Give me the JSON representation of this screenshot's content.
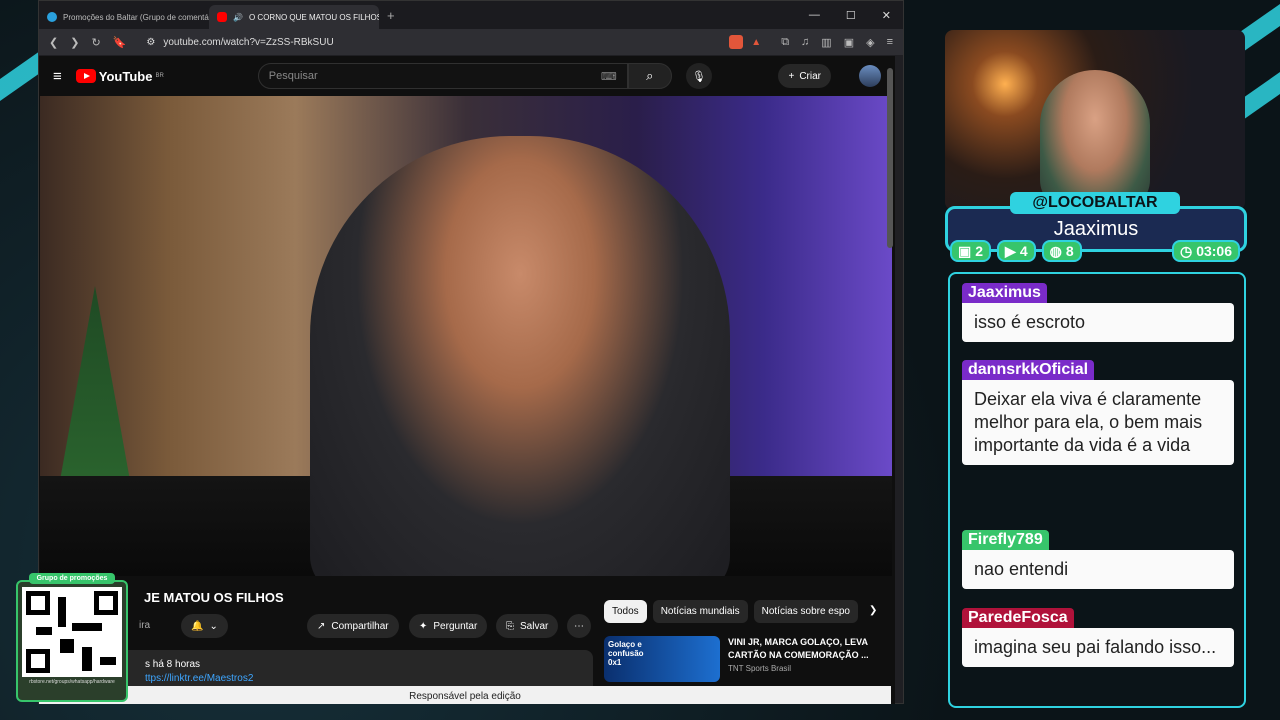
{
  "browser": {
    "tabs": [
      {
        "label": "Promoções do Baltar (Grupo de comentário...",
        "active": false
      },
      {
        "label": "O CORNO QUE MATOU OS FILHOS",
        "active": true
      }
    ],
    "url": "youtube.com/watch?v=ZzSS-RBkSUU"
  },
  "youtube": {
    "logo": "YouTube",
    "region": "BR",
    "search_placeholder": "Pesquisar",
    "create_label": "Criar",
    "video_title_partial": "JE MATOU OS FILHOS",
    "channel_partial": "ira",
    "share_label": "Compartilhar",
    "ask_label": "Perguntar",
    "save_label": "Salvar",
    "desc_time": "s há 8 horas",
    "desc_link": "ttps://linktr.ee/Maestros2",
    "chips": [
      "Todos",
      "Notícias mundiais",
      "Notícias sobre espo"
    ],
    "rec_title": "VINI JR, MARCA GOLAÇO, LEVA CARTÃO NA COMEMORAÇÃO ...",
    "rec_channel": "TNT Sports Brasil",
    "rec_thumb_text": "Golaço e confusão",
    "rec_score": "0x1",
    "footer": "Responsável pela edição"
  },
  "overlay": {
    "qr_header": "Grupo de promoções",
    "qr_footer": "rbstore.net/groups/whatsapp/hardware",
    "handle": "@LOCOBALTAR",
    "current_name": "Jaaximus",
    "stats": {
      "twitch": "2",
      "youtube": "4",
      "kick": "8",
      "timer": "03:06"
    },
    "accent": "#2fd2e0"
  },
  "chat": [
    {
      "user": "Jaaximus",
      "color": "#7a2bc9",
      "text": "isso é escroto"
    },
    {
      "user": "dannsrkkOficial",
      "color": "#7a2bc9",
      "text": "Deixar ela viva é claramente melhor para ela, o bem mais importante da vida é a vida"
    },
    {
      "user": "Firefly789",
      "color": "#37c56b",
      "text": "nao entendi"
    },
    {
      "user": "ParedeFosca",
      "color": "#b0123a",
      "text": "imagina seu pai falando isso..."
    }
  ]
}
